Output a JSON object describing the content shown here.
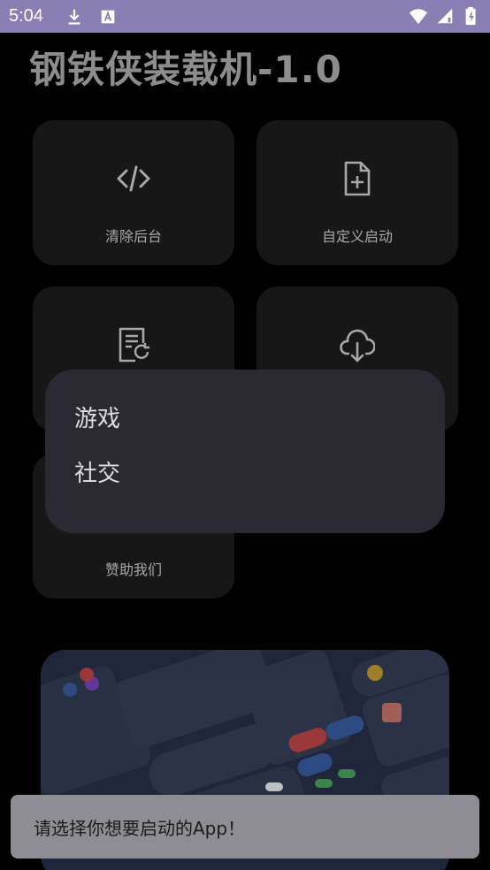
{
  "status_bar": {
    "time": "5:04",
    "left_icons": [
      "download-icon",
      "text-a-icon"
    ],
    "right_icons": [
      "wifi-icon",
      "signal-icon",
      "battery-icon"
    ],
    "background": "#8a7fb2"
  },
  "header": {
    "title": "钢铁侠装载机-1.0"
  },
  "cards": [
    {
      "label": "清除后台",
      "icon": "code-icon"
    },
    {
      "label": "自定义启动",
      "icon": "file-add-icon"
    },
    {
      "label": "",
      "icon": "document-refresh-icon"
    },
    {
      "label": "",
      "icon": "cloud-download-icon"
    },
    {
      "label": "赞助我们",
      "icon": ""
    }
  ],
  "popup": {
    "items": [
      "游戏",
      "社交"
    ]
  },
  "toast": {
    "message": "请选择你想要启动的App！"
  },
  "colors": {
    "background": "#000000",
    "card": "#171717",
    "popup": "#2b2a33",
    "toast": "#8e8d93"
  }
}
